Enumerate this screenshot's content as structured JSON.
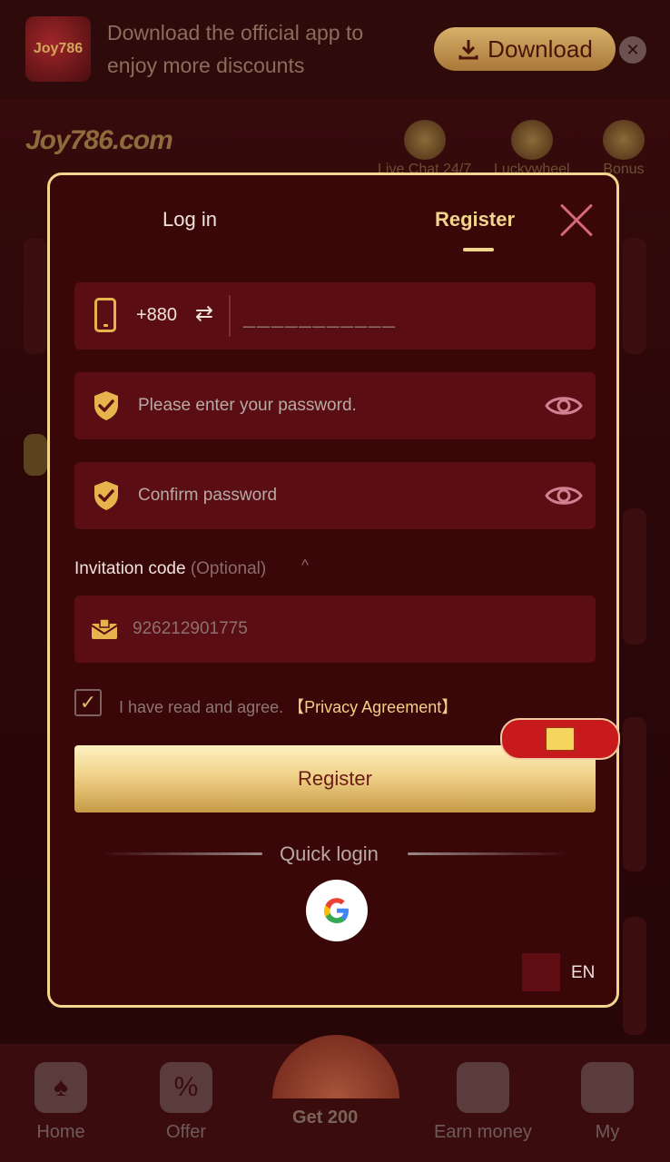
{
  "banner": {
    "logo_text": "Joy786",
    "text": "Download the official app to enjoy more discounts",
    "download_label": "Download",
    "close_glyph": "✕"
  },
  "header": {
    "logo_text": "Joy786.com",
    "nav": [
      {
        "label": "Live Chat 24/7",
        "icon": "headset-icon"
      },
      {
        "label": "Luckywheel",
        "icon": "wheel-icon"
      },
      {
        "label": "Bonus",
        "icon": "gift-icon"
      }
    ]
  },
  "modal": {
    "tabs": [
      {
        "label": "Log in",
        "active": false
      },
      {
        "label": "Register",
        "active": true
      }
    ],
    "phone": {
      "country_code": "+880",
      "swap_glyph": "⇄",
      "placeholder": "___________"
    },
    "password": {
      "placeholder": "Please enter your password."
    },
    "confirm_password": {
      "placeholder": "Confirm password"
    },
    "invitation": {
      "label": "Invitation code",
      "optional": "(Optional)",
      "caret": "^",
      "value": "926212901775"
    },
    "agreement": {
      "checked": true,
      "text": "I have read and agree.",
      "link": "【Privacy Agreement】"
    },
    "register_button": "Register",
    "quick_login": "Quick login",
    "language": "EN"
  },
  "bottom_nav": {
    "items": [
      {
        "label": "Home",
        "icon": "spade-icon"
      },
      {
        "label": "Offer",
        "icon": "percent-icon"
      },
      {
        "label": "Get 200",
        "icon": "wheel-icon"
      },
      {
        "label": "Earn money",
        "icon": "gift-icon"
      },
      {
        "label": "My",
        "icon": "smile-icon"
      }
    ]
  },
  "colors": {
    "accent_gold": "#f2d58c",
    "modal_bg": "#3a0709",
    "field_bg": "#5a0e13",
    "close_pink": "#d5677d"
  }
}
